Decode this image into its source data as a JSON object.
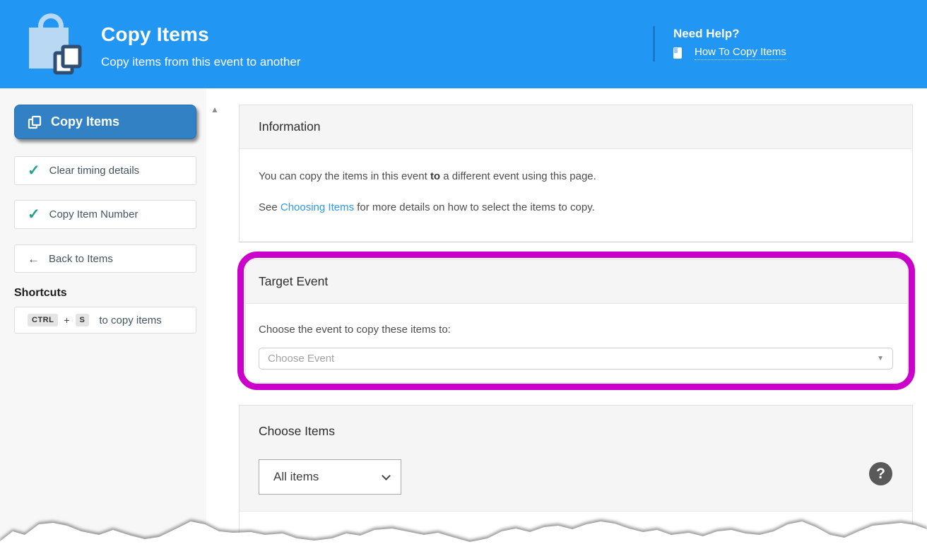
{
  "header": {
    "title": "Copy Items",
    "subtitle": "Copy items from this event to another",
    "need_help": "Need Help?",
    "help_link": "How To Copy Items"
  },
  "sidebar": {
    "active_item": "Copy Items",
    "toggles": [
      {
        "label": "Clear timing details",
        "checked": true
      },
      {
        "label": "Copy Item Number",
        "checked": true
      }
    ],
    "back_label": "Back to Items",
    "shortcuts_heading": "Shortcuts",
    "shortcut": {
      "key1": "CTRL",
      "plus": "+",
      "key2": "S",
      "desc": "to copy items"
    }
  },
  "panels": {
    "information": {
      "title": "Information",
      "p1_before": "You can copy the items in this event ",
      "p1_bold": "to",
      "p1_after": " a different event using this page.",
      "p2_before": "See ",
      "p2_link": "Choosing Items",
      "p2_after": " for more details on how to select the items to copy."
    },
    "target_event": {
      "title": "Target Event",
      "label": "Choose the event to copy these items to:",
      "placeholder": "Choose Event"
    },
    "choose_items": {
      "title": "Choose Items",
      "filter_value": "All items",
      "help_glyph": "?"
    }
  },
  "icons": {
    "scroll_up": "▲",
    "back_arrow": "←",
    "caret_down": "▼",
    "check": "✓"
  },
  "colors": {
    "header_blue": "#2196f3",
    "active_button_blue": "#3181c4",
    "highlight_magenta": "#cb00cb",
    "link_blue": "#2e97f0",
    "check_teal": "#21a38b"
  }
}
